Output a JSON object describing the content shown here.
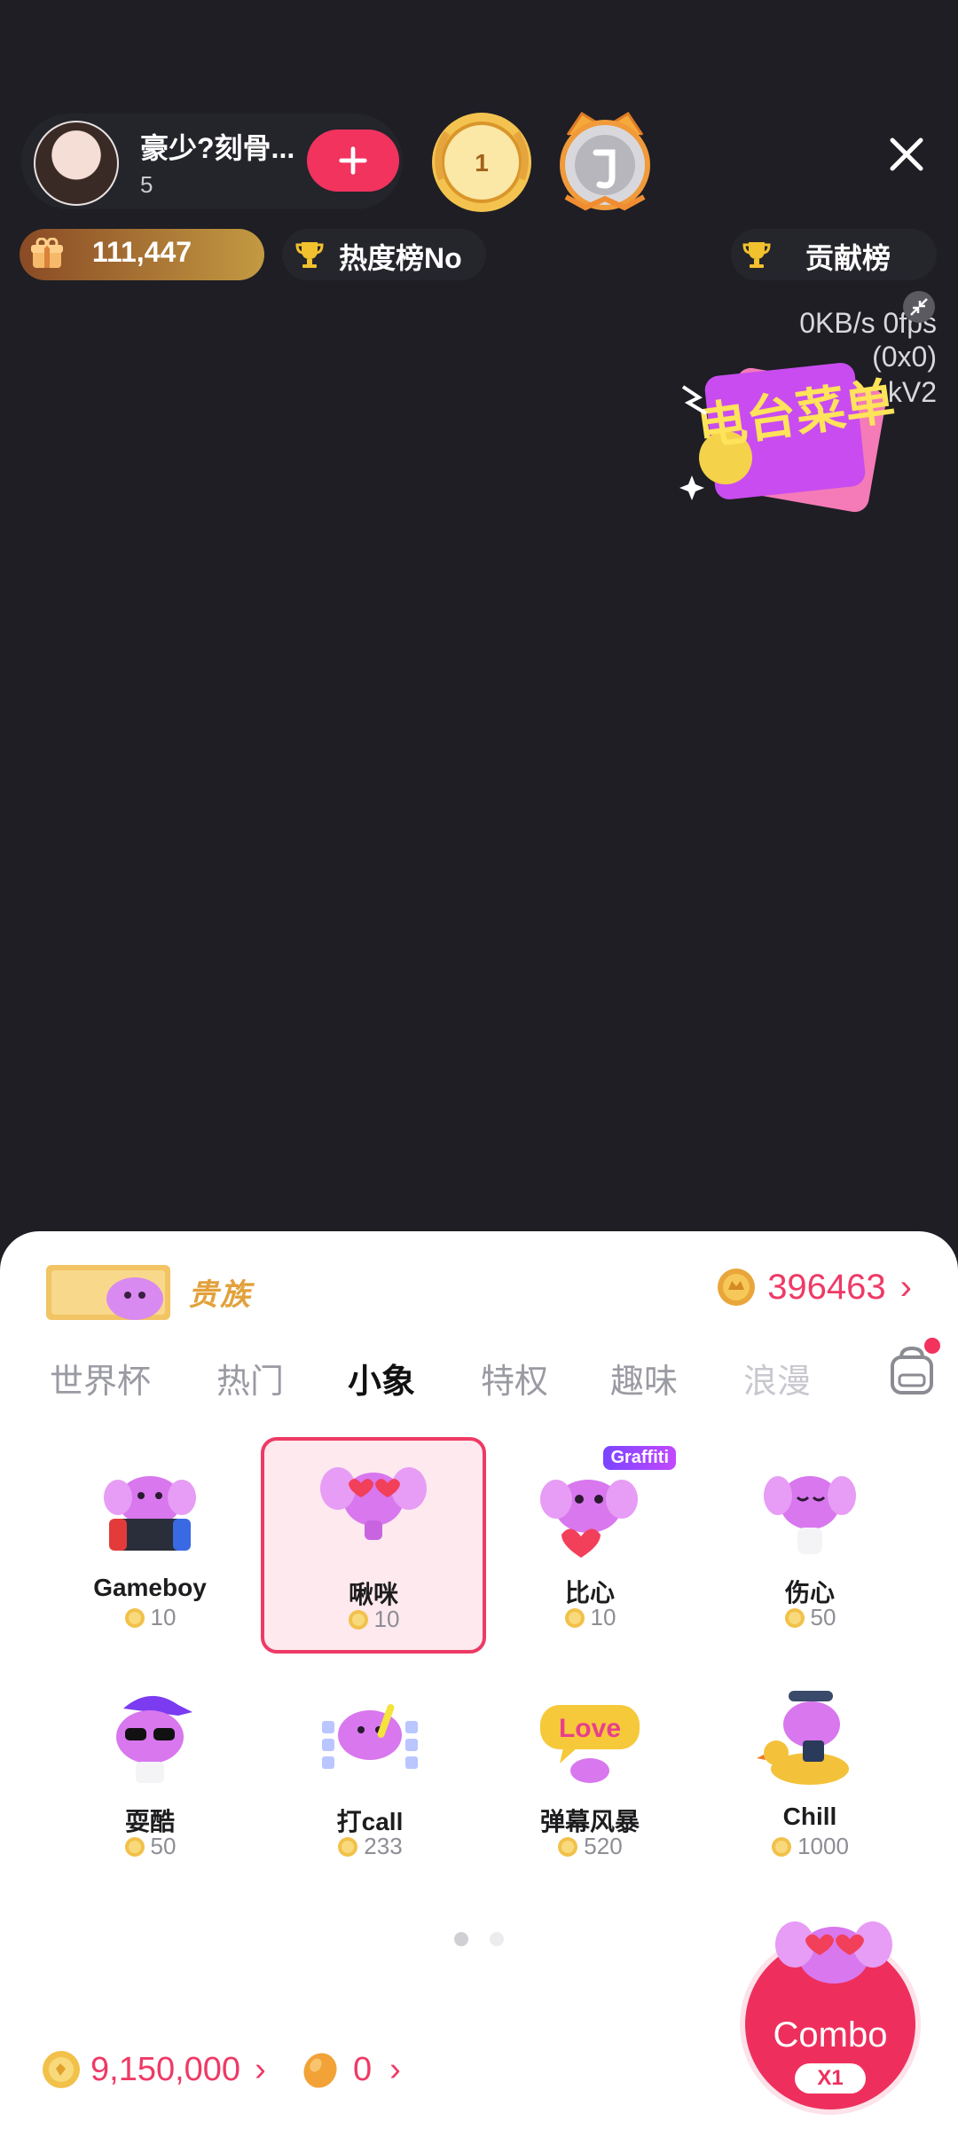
{
  "host": {
    "name": "豪少?刻骨...",
    "sub": "5",
    "rank_badge_1": "1"
  },
  "stats": {
    "gift_value": "111,447",
    "heat_label": "热度榜No",
    "contrib_label": "贡献榜"
  },
  "debug": {
    "line1": "0KB/s 0fps",
    "line2": "(0x0)",
    "line3": "Tenc...kV2"
  },
  "sticker": {
    "text": "电台菜单"
  },
  "panel": {
    "noble_label": "贵族",
    "coin_balance": "396463",
    "tabs": [
      "世界杯",
      "热门",
      "小象",
      "特权",
      "趣味",
      "浪漫"
    ],
    "active_tab": "小象",
    "gifts": [
      {
        "name": "Gameboy",
        "price": "10"
      },
      {
        "name": "啾咪",
        "price": "10"
      },
      {
        "name": "比心",
        "price": "10",
        "tag": "Graffiti"
      },
      {
        "name": "伤心",
        "price": "50"
      },
      {
        "name": "耍酷",
        "price": "50"
      },
      {
        "name": "打call",
        "price": "233"
      },
      {
        "name": "弹幕风暴",
        "price": "520"
      },
      {
        "name": "Chill",
        "price": "1000"
      }
    ],
    "selected_gift": "啾咪",
    "page_count": 2,
    "current_page": 1
  },
  "footer": {
    "coins": "9,150,000",
    "beans": "0"
  },
  "combo": {
    "label": "Combo",
    "multiplier": "X1"
  },
  "colors": {
    "accent": "#ee3a66",
    "follow": "#f1335e",
    "background": "#1e1e24"
  }
}
